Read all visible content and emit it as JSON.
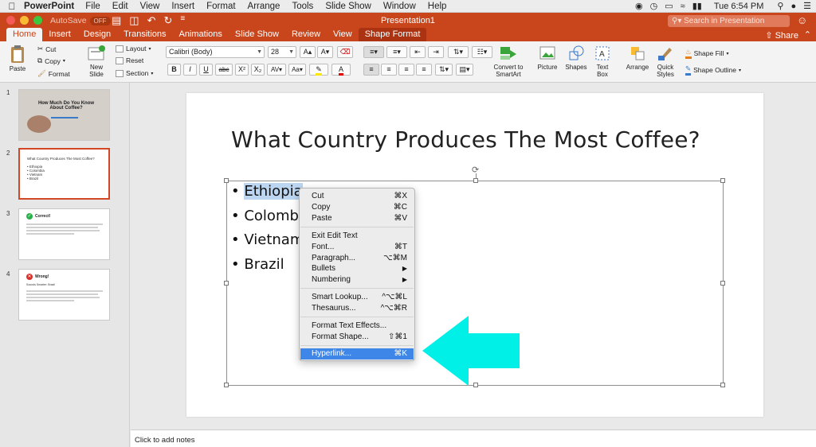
{
  "menubar": {
    "app": "PowerPoint",
    "menus": [
      "File",
      "Edit",
      "View",
      "Insert",
      "Format",
      "Arrange",
      "Tools",
      "Slide Show",
      "Window",
      "Help"
    ],
    "clock": "Tue 6:54 PM"
  },
  "titlebar": {
    "autosave_label": "AutoSave",
    "autosave_state": "OFF",
    "doc_title": "Presentation1",
    "search_placeholder": "Search in Presentation",
    "share_label": "Share"
  },
  "tabs": [
    "Home",
    "Insert",
    "Design",
    "Transitions",
    "Animations",
    "Slide Show",
    "Review",
    "View",
    "Shape Format"
  ],
  "ribbon": {
    "paste": "Paste",
    "cut": "Cut",
    "copy": "Copy",
    "format": "Format",
    "new_slide_l1": "New",
    "new_slide_l2": "Slide",
    "layout": "Layout",
    "reset": "Reset",
    "section": "Section",
    "font_name": "Calibri (Body)",
    "font_size": "28",
    "convert_l1": "Convert to",
    "convert_l2": "SmartArt",
    "picture": "Picture",
    "shapes": "Shapes",
    "textbox_l1": "Text",
    "textbox_l2": "Box",
    "arrange": "Arrange",
    "quick_l1": "Quick",
    "quick_l2": "Styles",
    "shape_fill": "Shape Fill",
    "shape_outline": "Shape Outline"
  },
  "thumbnails": [
    {
      "num": "1",
      "title": "How Much Do You Know About Coffee?"
    },
    {
      "num": "2",
      "title": "What Country Produces The Most Coffee?",
      "items": [
        "Ethiopia",
        "Colombia",
        "Vietnam",
        "Brazil"
      ]
    },
    {
      "num": "3",
      "title": "Correct!"
    },
    {
      "num": "4",
      "title": "Wrong!",
      "subtitle": "Sounds Smarter: Brazil"
    }
  ],
  "slide": {
    "title": "What Country Produces The Most Coffee?",
    "bullets": [
      "Ethiopia",
      "Colombia",
      "Vietnam",
      "Brazil"
    ],
    "visible_bullets": [
      "Ethiopia",
      "Colombi",
      "Vietnam",
      "Brazil"
    ]
  },
  "context_menu": [
    {
      "label": "Cut",
      "shortcut": "⌘X"
    },
    {
      "label": "Copy",
      "shortcut": "⌘C"
    },
    {
      "label": "Paste",
      "shortcut": "⌘V"
    },
    {
      "label": "Exit Edit Text",
      "shortcut": ""
    },
    {
      "label": "Font...",
      "shortcut": "⌘T"
    },
    {
      "label": "Paragraph...",
      "shortcut": "⌥⌘M"
    },
    {
      "label": "Bullets",
      "shortcut": "▶"
    },
    {
      "label": "Numbering",
      "shortcut": "▶"
    },
    {
      "label": "Smart Lookup...",
      "shortcut": "^⌥⌘L"
    },
    {
      "label": "Thesaurus...",
      "shortcut": "^⌥⌘R"
    },
    {
      "label": "Format Text Effects...",
      "shortcut": ""
    },
    {
      "label": "Format Shape...",
      "shortcut": "⇧⌘1"
    },
    {
      "label": "Hyperlink...",
      "shortcut": "⌘K"
    }
  ],
  "notes_placeholder": "Click to add notes",
  "colors": {
    "accent": "#c9451c",
    "menu_highlight": "#3e87e9",
    "arrow": "#00f0e8"
  }
}
